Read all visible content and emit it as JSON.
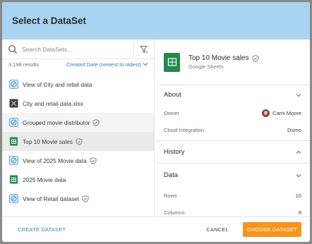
{
  "modal": {
    "title": "Select a DataSet"
  },
  "search": {
    "placeholder": "Search DataSets...",
    "value": ""
  },
  "results": {
    "count": "3,198 results",
    "sort": "Created Date (newest to oldest)"
  },
  "list": [
    {
      "label": "View of City and retail data",
      "icon": "view-icon",
      "certified": false
    },
    {
      "label": "City and retail data.xlsx",
      "icon": "excel-icon",
      "certified": false
    },
    {
      "label": "Grouped movie distributor",
      "icon": "view-icon",
      "certified": true
    },
    {
      "label": "Top 10 Movie sales",
      "icon": "google-sheets-icon",
      "certified": true
    },
    {
      "label": "View of 2025 Movie data",
      "icon": "view-icon",
      "certified": true
    },
    {
      "label": "2025 Movie data",
      "icon": "google-sheets-icon",
      "certified": false
    },
    {
      "label": "View of Retail dataset",
      "icon": "view-icon",
      "certified": true
    }
  ],
  "detail": {
    "title": "Top 10 Movie sales",
    "source": "Google Sheets",
    "about": {
      "heading": "About",
      "owner_label": "Owner",
      "owner_value": "Cami Moore",
      "cloud_label": "Cloud Integration",
      "cloud_value": "Domo"
    },
    "history": {
      "heading": "History"
    },
    "data": {
      "heading": "Data",
      "rows_label": "Rows",
      "rows_value": "10",
      "columns_label": "Columns",
      "columns_value": "8"
    }
  },
  "footer": {
    "create_label": "CREATE DATASET",
    "cancel_label": "CANCEL",
    "choose_label": "CHOOSE DATASET"
  },
  "colors": {
    "header": "#a9d4f2",
    "accent": "#f7931e",
    "link": "#3f7fb5",
    "sheets": "#1f8a4c"
  }
}
